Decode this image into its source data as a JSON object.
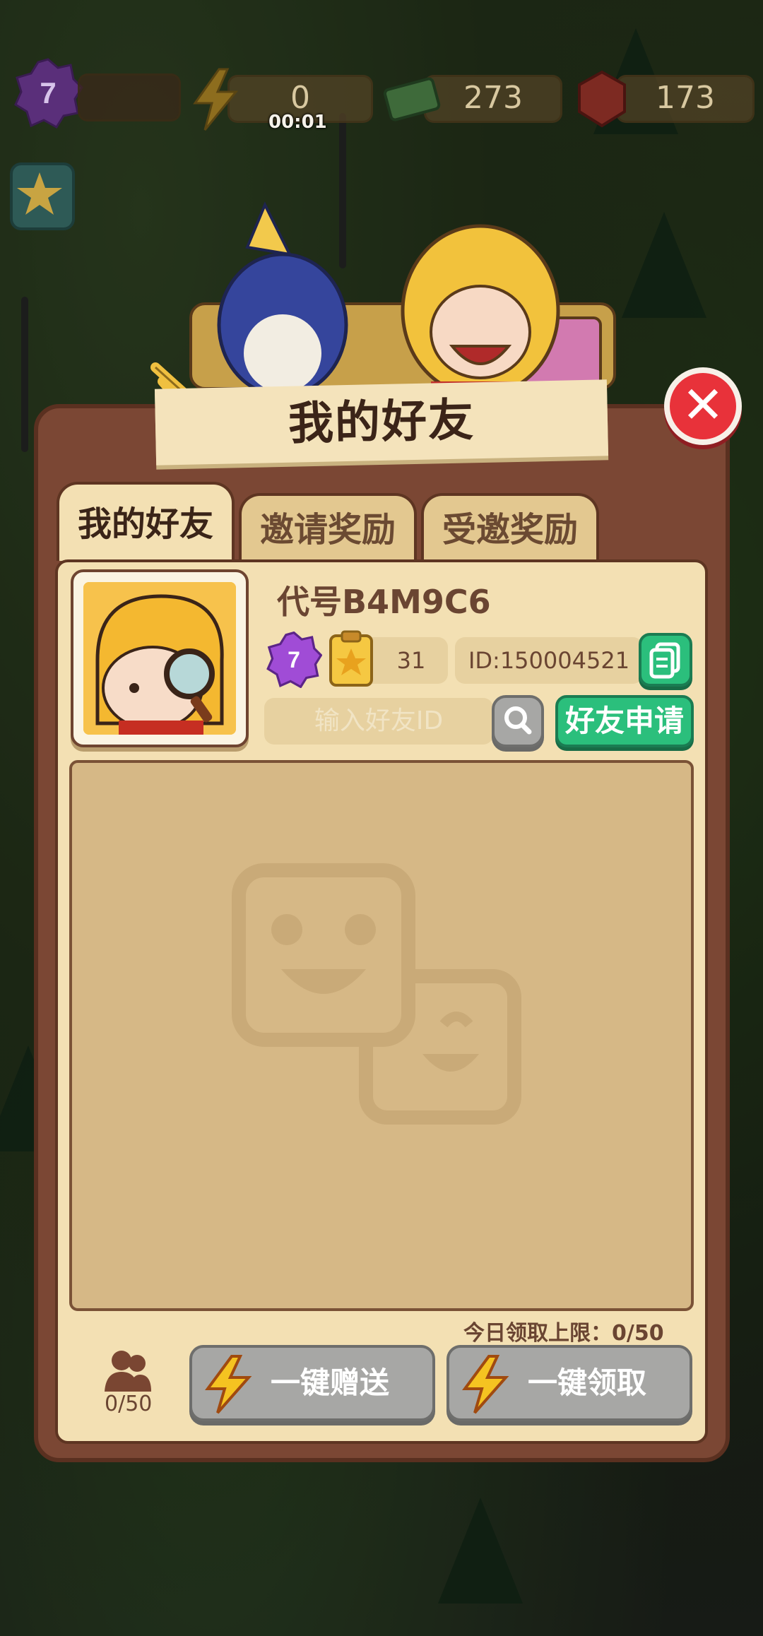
{
  "hud": {
    "level": "7",
    "energy": "0",
    "timer": "00:01",
    "cash": "273",
    "gems": "173"
  },
  "dialog": {
    "title": "我的好友",
    "tabs": [
      {
        "label": "我的好友",
        "active": true
      },
      {
        "label": "邀请奖励",
        "active": false
      },
      {
        "label": "受邀奖励",
        "active": false
      }
    ],
    "profile": {
      "nickname": "代号B4M9C6",
      "level": "7",
      "stars": "31",
      "id_text": "ID:150004521"
    },
    "search": {
      "placeholder": "输入好友ID",
      "request_button": "好友申请"
    },
    "daily_limit": "今日领取上限：0/50",
    "friend_count": "0/50",
    "send_all_button": "一键赠送",
    "claim_all_button": "一键领取"
  },
  "colors": {
    "panel_brown": "#7b4734",
    "panel_cream": "#f3e0b3",
    "accent_green": "#2bbf7c",
    "close_red": "#e8323a",
    "disabled_gray": "#a7a7a5"
  }
}
